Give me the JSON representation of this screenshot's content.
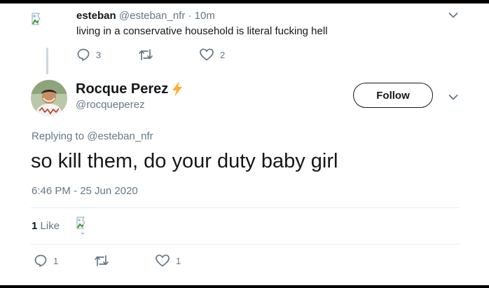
{
  "parent": {
    "name": "esteban",
    "handle": "@esteban_nfr",
    "separator": "·",
    "time": "10m",
    "text": "living in a conservative household is literal fucking hell",
    "reply_count": "3",
    "like_count": "2"
  },
  "tweet": {
    "name": "Rocque Perez",
    "emoji": "⚡",
    "handle": "@rocqueperez",
    "follow_label": "Follow",
    "replying_prefix": "Replying to",
    "replying_handle": "@esteban_nfr",
    "text": "so kill them, do your duty baby girl",
    "timestamp": "6:46 PM - 25 Jun 2020",
    "likes_count": "1",
    "likes_label": "Like",
    "reply_count": "1",
    "like_count": "1"
  },
  "colors": {
    "text": "#14171a",
    "secondary": "#657786",
    "divider": "#e6ecf0",
    "lightning": "#ffac33"
  },
  "icons": [
    "broken-image-icon",
    "reply-icon",
    "retweet-icon",
    "heart-icon",
    "chevron-down-icon",
    "lightning-icon"
  ]
}
